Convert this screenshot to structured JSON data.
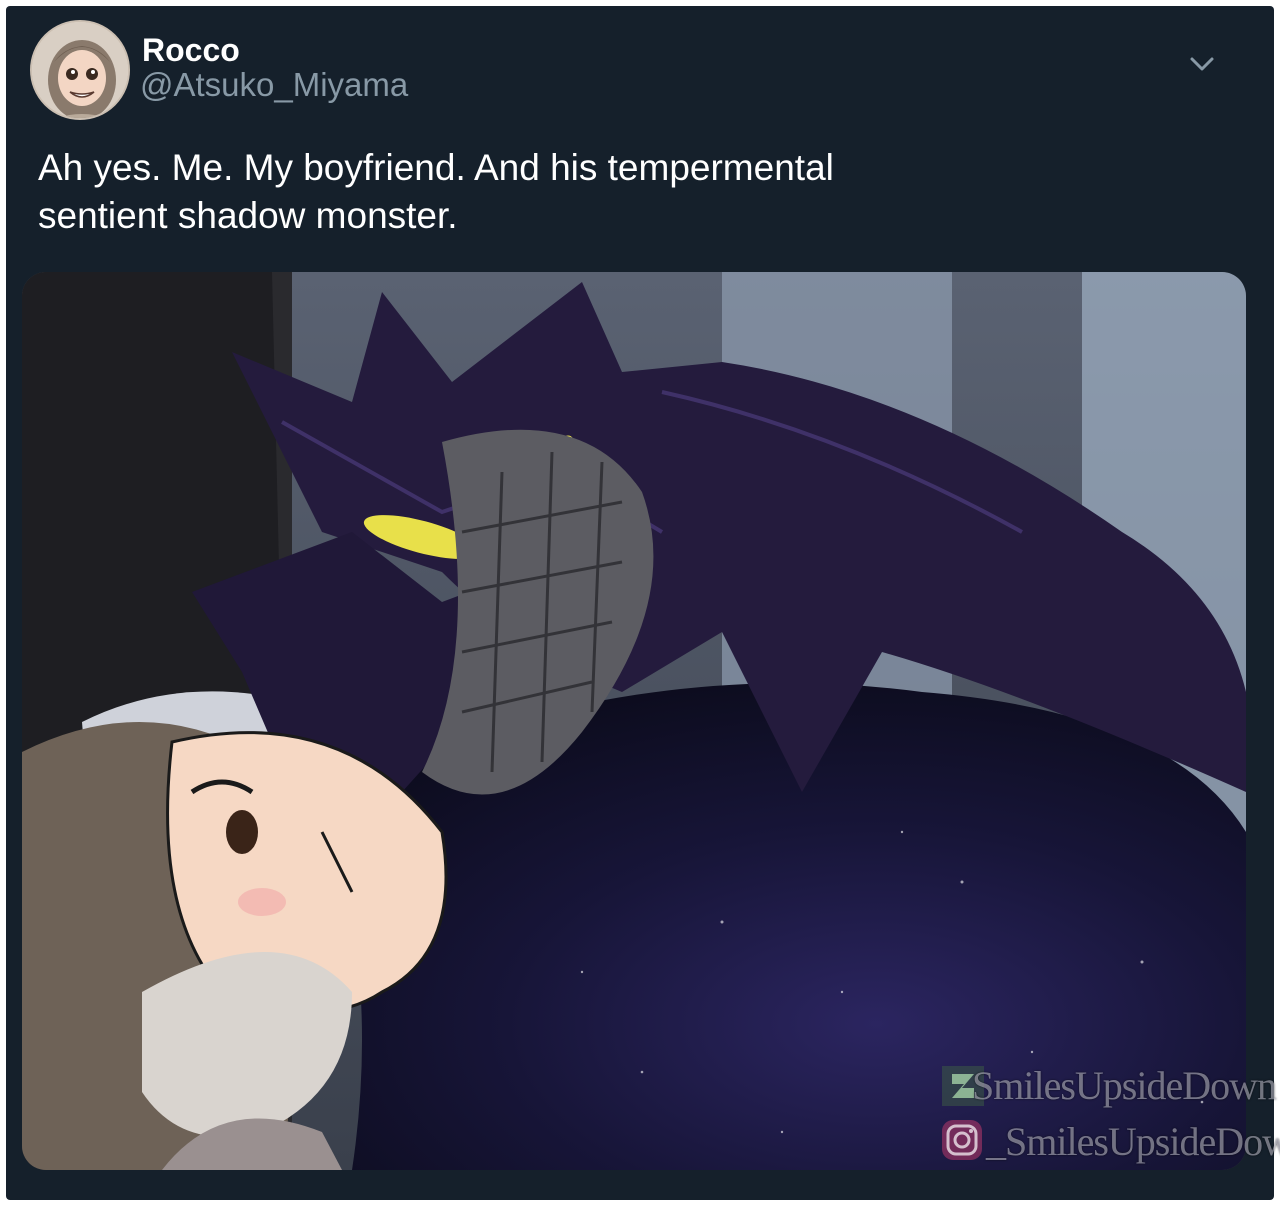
{
  "tweet": {
    "display_name": "Rocco",
    "handle": "@Atsuko_Miyama",
    "text_line1": "Ah yes. Me. My boyfriend. And his tempermental",
    "text_line2": "sentient shadow monster.",
    "menu_icon": "chevron-down-icon"
  },
  "media": {
    "watermark_deviantart": "SmilesUpsideDown",
    "watermark_instagram": "_SmilesUpsideDown_",
    "deviantart_icon": "deviantart-icon",
    "instagram_icon": "instagram-icon"
  },
  "colors": {
    "background": "#15202b",
    "text": "#ffffff",
    "secondary_text": "#8899a6"
  }
}
